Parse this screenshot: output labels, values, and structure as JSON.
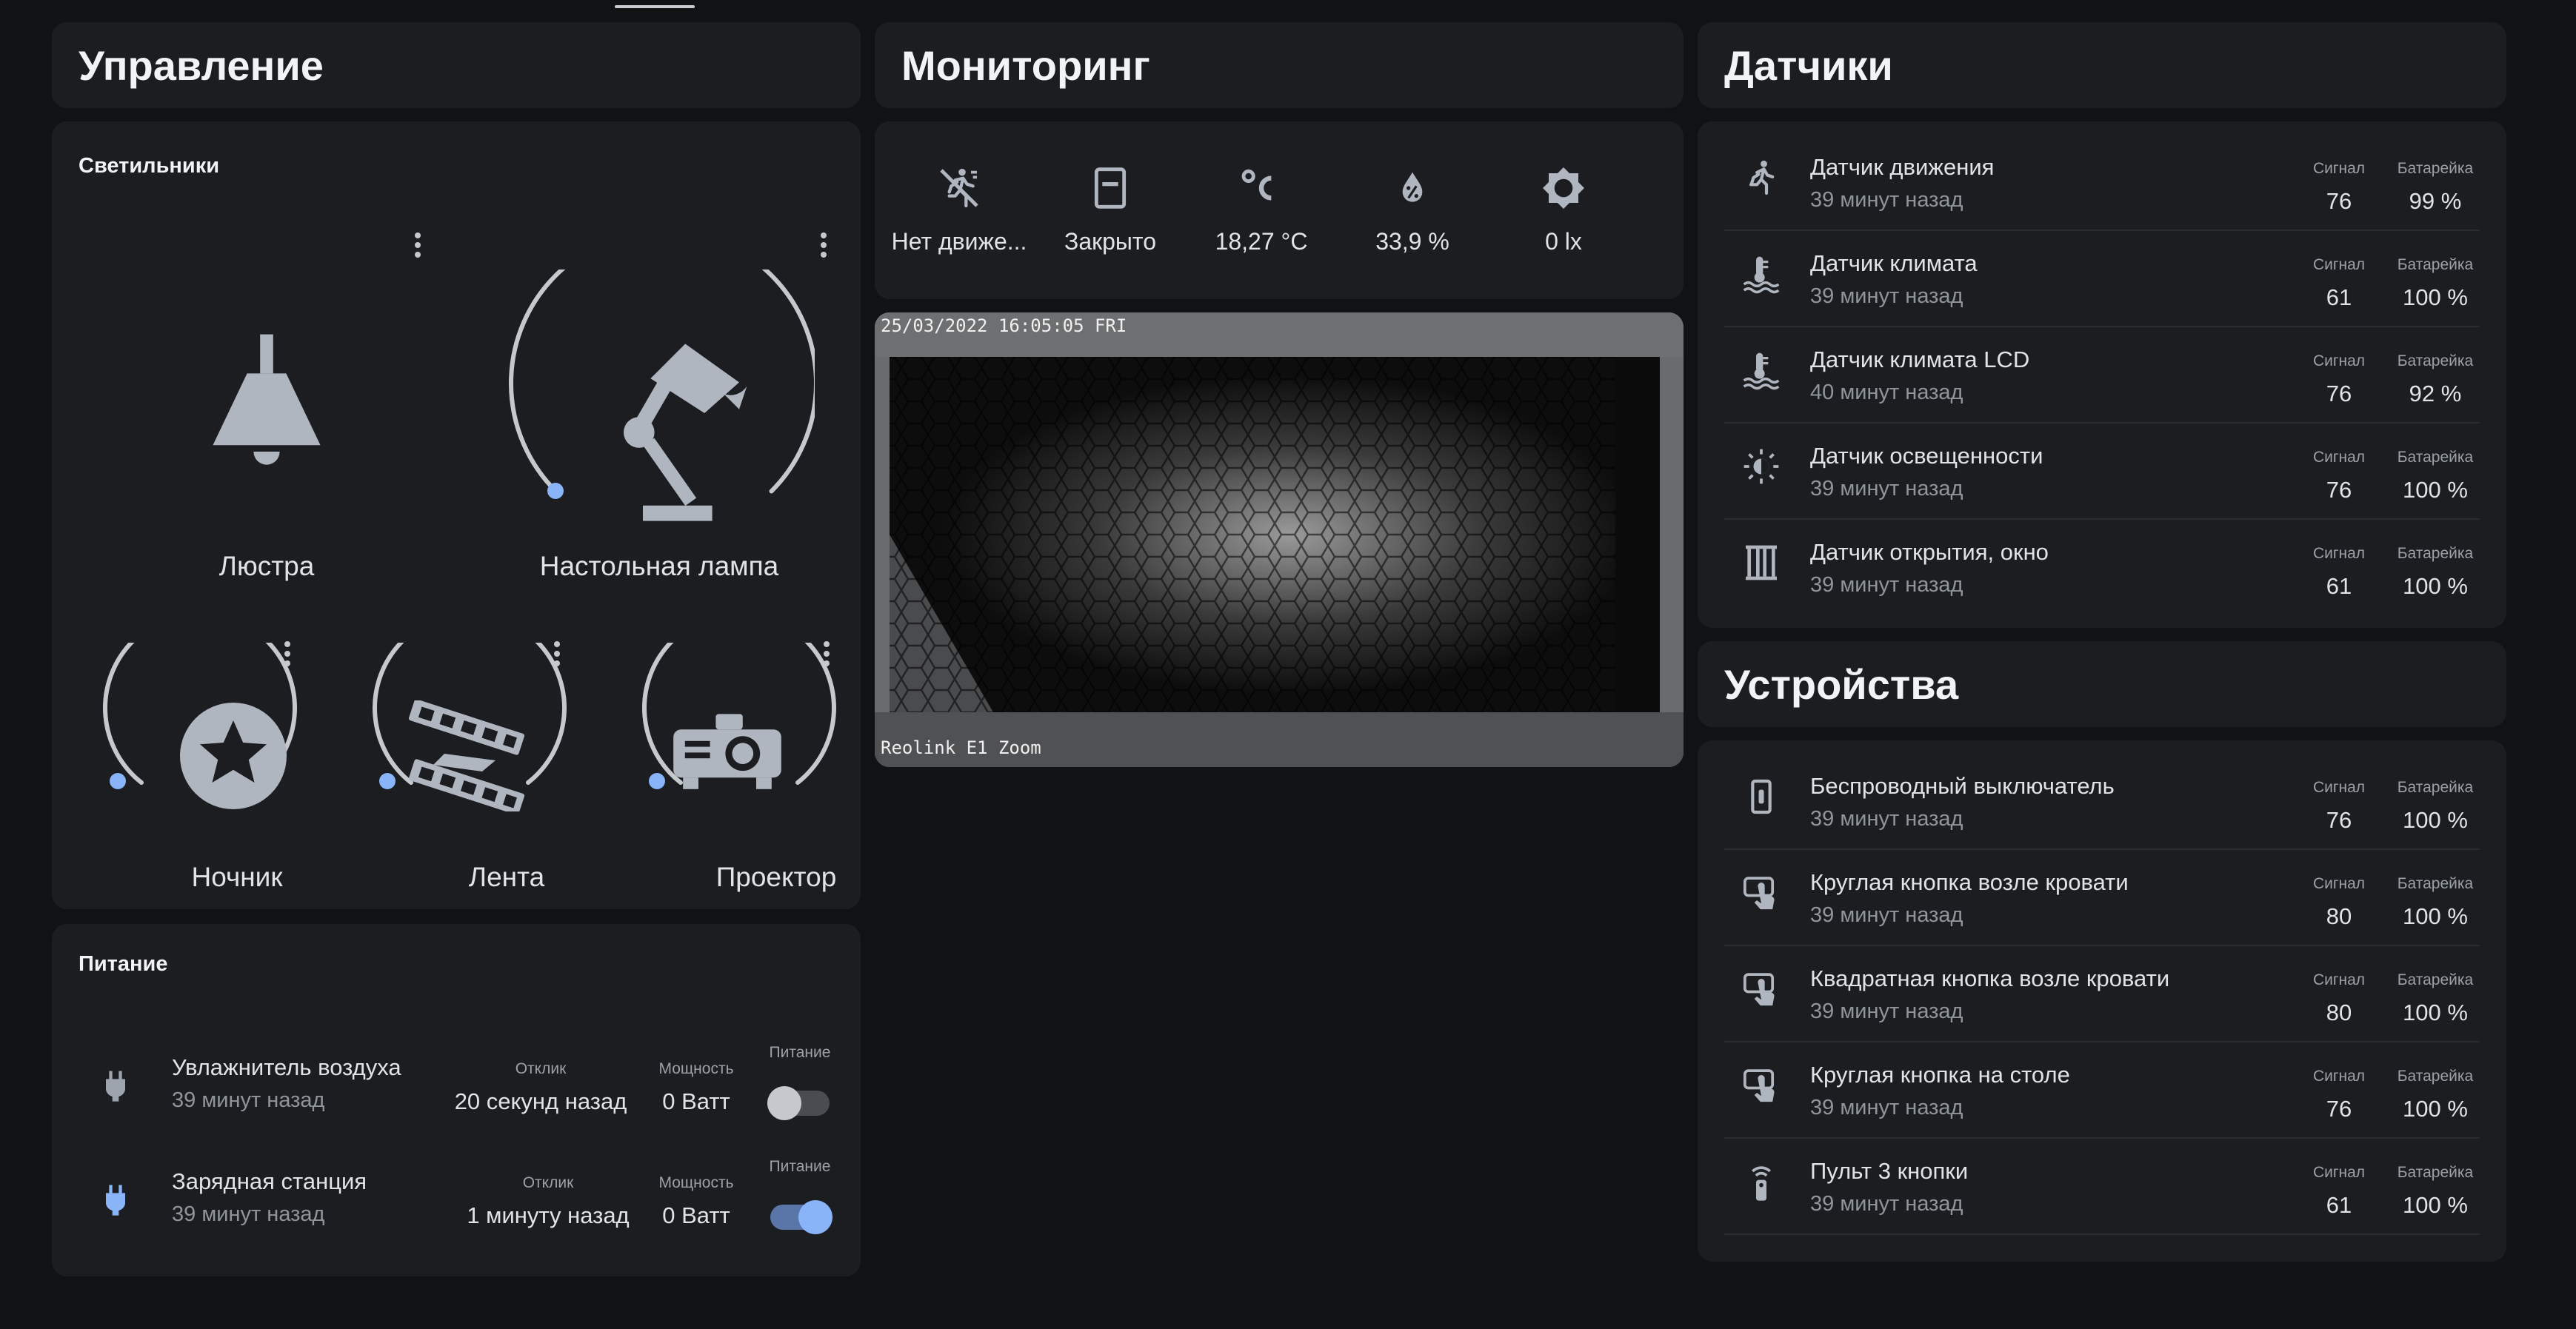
{
  "columns": {
    "control": "Управление",
    "monitoring": "Мониторинг",
    "sensors": "Датчики",
    "devices": "Устройства"
  },
  "lights": {
    "title": "Светильники",
    "items": [
      {
        "name": "Люстра",
        "icon": "ceiling-lamp-icon"
      },
      {
        "name": "Настольная лампа",
        "icon": "desk-lamp-icon"
      },
      {
        "name": "Ночник",
        "icon": "star-icon"
      },
      {
        "name": "Лента",
        "icon": "led-strip-icon"
      },
      {
        "name": "Проектор",
        "icon": "projector-icon"
      }
    ]
  },
  "power": {
    "title": "Питание",
    "rows": [
      {
        "name": "Увлажнитель воздуха",
        "time": "39 минут назад",
        "response_label": "Отклик",
        "response": "20 секунд назад",
        "power_label": "Мощность",
        "power": "0 Ватт",
        "switch_label": "Питание",
        "on": false,
        "icon": "plug-icon"
      },
      {
        "name": "Зарядная станция",
        "time": "39 минут назад",
        "response_label": "Отклик",
        "response": "1 минуту назад",
        "power_label": "Мощность",
        "power": "0 Ватт",
        "switch_label": "Питание",
        "on": true,
        "icon": "plug-icon"
      }
    ]
  },
  "monitoring": {
    "items": [
      {
        "value": "Нет движе...",
        "icon": "motion-off-icon"
      },
      {
        "value": "Закрыто",
        "icon": "door-closed-icon"
      },
      {
        "value": "18,27 °C",
        "icon": "celsius-icon"
      },
      {
        "value": "33,9 %",
        "icon": "humidity-icon"
      },
      {
        "value": "0 lx",
        "icon": "brightness-icon"
      }
    ],
    "camera": {
      "timestamp": "25/03/2022 16:05:05 FRI",
      "name": "Reolink E1 Zoom"
    }
  },
  "sensors": {
    "signal_label": "Сигнал",
    "battery_label": "Батарейка",
    "rows": [
      {
        "name": "Датчик движения",
        "time": "39 минут назад",
        "signal": "76",
        "battery": "99 %",
        "icon": "motion-sensor-icon"
      },
      {
        "name": "Датчик климата",
        "time": "39 минут назад",
        "signal": "61",
        "battery": "100 %",
        "icon": "thermometer-water-icon"
      },
      {
        "name": "Датчик климата LCD",
        "time": "40 минут назад",
        "signal": "76",
        "battery": "92 %",
        "icon": "thermometer-water-icon"
      },
      {
        "name": "Датчик освещенности",
        "time": "39 минут назад",
        "signal": "76",
        "battery": "100 %",
        "icon": "brightness-auto-icon"
      },
      {
        "name": "Датчик открытия, окно",
        "time": "39 минут назад",
        "signal": "61",
        "battery": "100 %",
        "icon": "window-closed-icon"
      }
    ]
  },
  "devices": {
    "signal_label": "Сигнал",
    "battery_label": "Батарейка",
    "rows": [
      {
        "name": "Беспроводный выключатель",
        "time": "39 минут назад",
        "signal": "76",
        "battery": "100 %",
        "icon": "light-switch-icon"
      },
      {
        "name": "Круглая кнопка возле кровати",
        "time": "39 минут назад",
        "signal": "80",
        "battery": "100 %",
        "icon": "gesture-tap-button-icon"
      },
      {
        "name": "Квадратная кнопка возле кровати",
        "time": "39 минут назад",
        "signal": "80",
        "battery": "100 %",
        "icon": "gesture-tap-button-icon"
      },
      {
        "name": "Круглая кнопка на столе",
        "time": "39 минут назад",
        "signal": "76",
        "battery": "100 %",
        "icon": "gesture-tap-button-icon"
      },
      {
        "name": "Пульт 3 кнопки",
        "time": "39 минут назад",
        "signal": "61",
        "battery": "100 %",
        "icon": "remote-icon"
      }
    ]
  },
  "colors": {
    "background": "#111213",
    "card": "#1c1d20",
    "accent": "#8ab4f8",
    "icon": "#b0b6c0"
  }
}
